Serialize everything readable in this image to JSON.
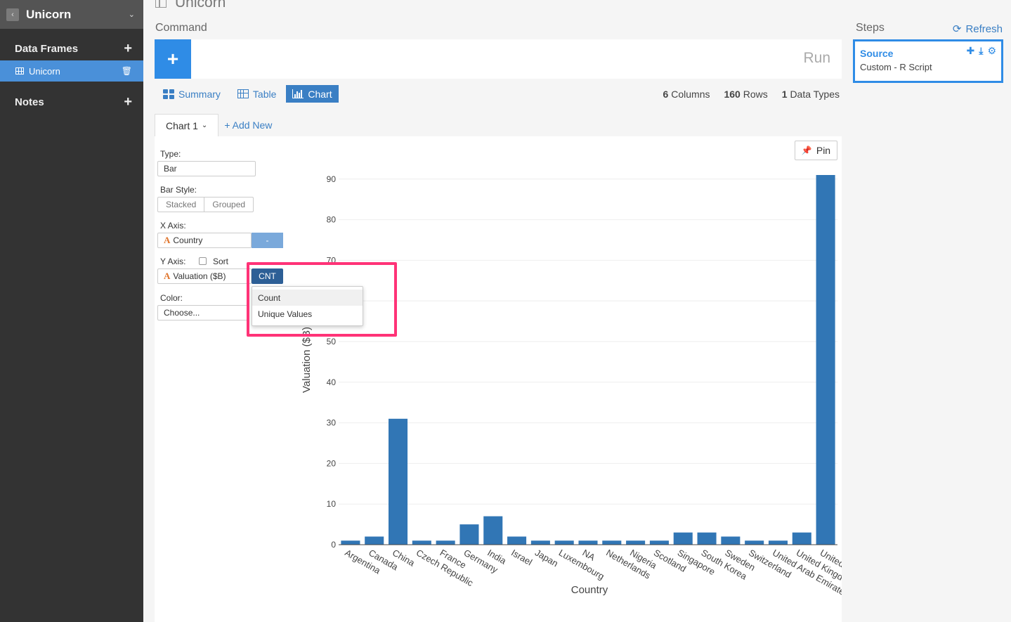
{
  "sidebar": {
    "title": "Unicorn",
    "data_frames_label": "Data Frames",
    "data_frame_items": [
      {
        "label": "Unicorn"
      }
    ],
    "notes_label": "Notes"
  },
  "main": {
    "title": "Unicorn",
    "command_label": "Command",
    "run_label": "Run",
    "tabs": [
      {
        "label": "Summary"
      },
      {
        "label": "Table"
      },
      {
        "label": "Chart"
      }
    ],
    "stats": {
      "columns": "6",
      "columns_label": "Columns",
      "rows": "160",
      "rows_label": "Rows",
      "types": "1",
      "types_label": "Data Types"
    },
    "chart_tab": "Chart 1",
    "add_new": "+ Add New",
    "pin": "Pin"
  },
  "config": {
    "type_label": "Type:",
    "type_value": "Bar",
    "bar_style_label": "Bar Style:",
    "bar_styles": [
      "Stacked",
      "Grouped"
    ],
    "x_axis_label": "X Axis:",
    "x_field": "Country",
    "x_agg": "-",
    "y_axis_label": "Y Axis:",
    "sort_label": "Sort",
    "y_field": "Valuation ($B)",
    "y_agg": "CNT",
    "agg_options": [
      "Count",
      "Unique Values"
    ],
    "color_label": "Color:",
    "color_placeholder": "Choose..."
  },
  "steps": {
    "label": "Steps",
    "refresh": "Refresh",
    "items": [
      {
        "title": "Source",
        "subtitle": "Custom - R Script"
      }
    ]
  },
  "colors": {
    "bar": "#3176b5",
    "accent": "#2f8ce6",
    "highlight": "#ff3377"
  },
  "chart_data": {
    "type": "bar",
    "categories": [
      "Argentina",
      "Canada",
      "China",
      "Czech Republic",
      "France",
      "Germany",
      "India",
      "Israel",
      "Japan",
      "Luxembourg",
      "NA",
      "Netherlands",
      "Nigeria",
      "Scotland",
      "Singapore",
      "South Korea",
      "Sweden",
      "Switzerland",
      "United Arab Emirates",
      "United Kingdom",
      "United States"
    ],
    "tick_labels": [
      "Argentina",
      "Canada",
      "China",
      "Czech Republic",
      "France",
      "Germany",
      "India",
      "Israel",
      "Japan",
      "Luxembourg",
      "NA",
      "Netherlands",
      "Nigeria",
      "Scotland",
      "Singapore",
      "South Korea",
      "Sweden",
      "Switzerland",
      "United Arab Emirate",
      "United Kingdo",
      "United"
    ],
    "values": [
      1,
      2,
      31,
      1,
      1,
      5,
      7,
      2,
      1,
      1,
      1,
      1,
      1,
      1,
      3,
      3,
      2,
      1,
      1,
      3,
      91
    ],
    "xlabel": "Country",
    "ylabel": "Valuation ($B)",
    "ylim": [
      0,
      91
    ],
    "yticks": [
      0,
      10,
      20,
      30,
      40,
      50,
      60,
      70,
      80,
      90
    ],
    "grid": true
  }
}
